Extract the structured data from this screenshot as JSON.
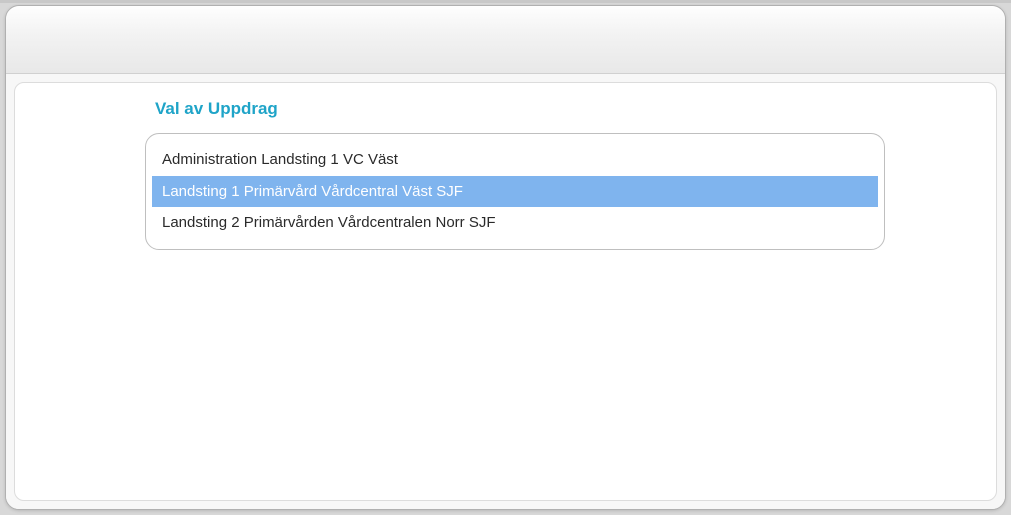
{
  "panel": {
    "title": "Val av Uppdrag"
  },
  "assignments": {
    "items": [
      {
        "label": "Administration Landsting 1 VC Väst",
        "selected": false
      },
      {
        "label": "Landsting 1 Primärvård Vårdcentral Väst SJF",
        "selected": true
      },
      {
        "label": "Landsting 2 Primärvården Vårdcentralen Norr SJF",
        "selected": false
      }
    ]
  }
}
